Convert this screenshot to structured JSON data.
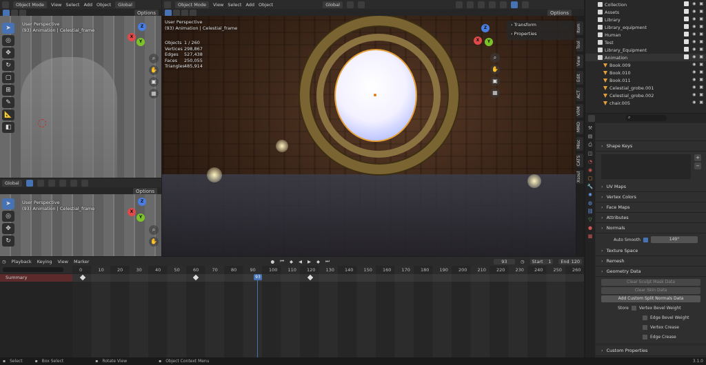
{
  "vp1": {
    "mode": "Object Mode",
    "menus": [
      "View",
      "Select",
      "Add",
      "Object"
    ],
    "orient": "Global",
    "options": "Options",
    "overlay_line1": "User Perspective",
    "overlay_line2": "(93) Animation | Celestial_frame"
  },
  "vp2": {
    "orient": "Global",
    "options": "Options",
    "overlay_line1": "User Perspective",
    "overlay_line2": "(93) Animation | Celestial_frame"
  },
  "main_vp": {
    "mode": "Object Mode",
    "menus": [
      "View",
      "Select",
      "Add",
      "Object"
    ],
    "orient": "Global",
    "options": "Options",
    "overlay_line1": "User Perspective",
    "overlay_line2": "(93) Animation | Celestial_frame",
    "stats": [
      {
        "label": "Objects",
        "value": "1 / 260"
      },
      {
        "label": "Vertices",
        "value": "298,867"
      },
      {
        "label": "Edges",
        "value": "527,438"
      },
      {
        "label": "Faces",
        "value": "250,055"
      },
      {
        "label": "Triangles",
        "value": "485,914"
      }
    ],
    "npanel": [
      "Transform",
      "Properties"
    ],
    "side_tabs": [
      "Item",
      "Tool",
      "View",
      "Edit",
      "ACT",
      "VRM",
      "MMD",
      "Misc",
      "CATS",
      "Xsoul"
    ]
  },
  "outliner": {
    "rows": [
      {
        "name": "Collection",
        "indent": 1
      },
      {
        "name": "Assets",
        "indent": 1
      },
      {
        "name": "Library",
        "indent": 1
      },
      {
        "name": "Library_equipment",
        "indent": 1
      },
      {
        "name": "Human",
        "indent": 1
      },
      {
        "name": "Test",
        "indent": 1
      },
      {
        "name": "Library_Equipment",
        "indent": 1
      },
      {
        "name": "Animation",
        "indent": 1
      },
      {
        "name": "Book.009",
        "indent": 2
      },
      {
        "name": "Book.010",
        "indent": 2
      },
      {
        "name": "Book.011",
        "indent": 2
      },
      {
        "name": "Celestial_grobe.001",
        "indent": 2
      },
      {
        "name": "Celestial_grobe.002",
        "indent": 2
      },
      {
        "name": "chair.005",
        "indent": 2
      }
    ]
  },
  "properties": {
    "sections_top": [
      "Shape Keys"
    ],
    "sections": [
      "UV Maps",
      "Vertex Colors",
      "Face Maps",
      "Attributes",
      "Normals"
    ],
    "auto_smooth_label": "Auto Smooth",
    "auto_smooth_value": "149°",
    "sections2": [
      "Texture Space",
      "Remesh",
      "Geometry Data"
    ],
    "buttons": [
      "Clear Sculpt Mask Data",
      "Clear Skin Data",
      "Add Custom Split Normals Data"
    ],
    "store_label": "Store",
    "store_items": [
      "Vertex Bevel Weight",
      "Edge Bevel Weight",
      "Vertex Crease",
      "Edge Crease"
    ],
    "custom_props": "Custom Properties"
  },
  "timeline": {
    "menus": [
      "Playback",
      "Keying",
      "View",
      "Marker"
    ],
    "current_frame": "93",
    "start_label": "Start",
    "start": "1",
    "end_label": "End",
    "end": "120",
    "summary": "Summary",
    "ticks": [
      "0",
      "10",
      "20",
      "30",
      "40",
      "50",
      "60",
      "70",
      "80",
      "90",
      "100",
      "110",
      "120",
      "130",
      "140",
      "150",
      "160",
      "170",
      "180",
      "190",
      "200",
      "210",
      "220",
      "230",
      "240",
      "250",
      "260"
    ]
  },
  "status": {
    "select": "Select",
    "box_select": "Box Select",
    "rotate": "Rotate View",
    "context": "Object Context Menu",
    "version": "3.1.0"
  }
}
